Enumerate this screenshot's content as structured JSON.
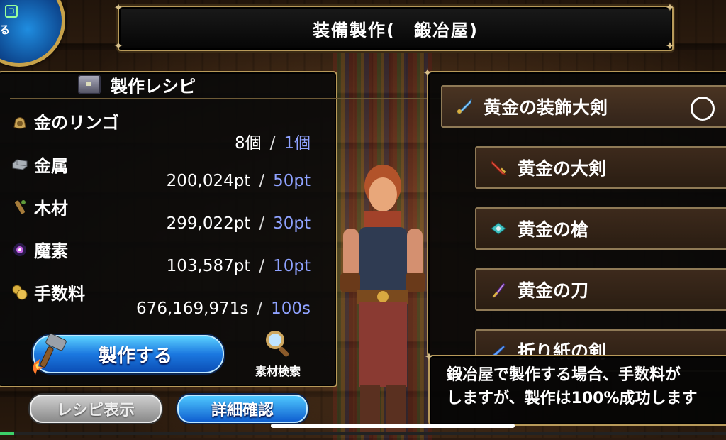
{
  "title": "装備製作(　鍛冶屋)",
  "corner_badge": {
    "label": "る",
    "icon": "menu-icon"
  },
  "recipe": {
    "heading": "製作レシピ",
    "materials": [
      {
        "name": "金のリンゴ",
        "have": "8個",
        "need": "1個",
        "icon": "apple-bag-icon"
      },
      {
        "name": "金属",
        "have": "200,024pt",
        "need": "50pt",
        "icon": "metal-ingot-icon"
      },
      {
        "name": "木材",
        "have": "299,022pt",
        "need": "30pt",
        "icon": "wood-icon"
      },
      {
        "name": "魔素",
        "have": "103,587pt",
        "need": "10pt",
        "icon": "magic-orb-icon"
      },
      {
        "name": "手数料",
        "have": "676,169,971s",
        "need": "100s",
        "icon": "coins-icon"
      }
    ],
    "separator": "/"
  },
  "buttons": {
    "make": "製作する",
    "material_search": "素材検索",
    "show_recipe": "レシピ表示",
    "details": "詳細確認"
  },
  "items": [
    {
      "name": "黄金の装飾大剣",
      "icon": "ornate-sword-icon",
      "selected": true
    },
    {
      "name": "黄金の大剣",
      "icon": "greatsword-icon"
    },
    {
      "name": "黄金の槍",
      "icon": "spear-icon"
    },
    {
      "name": "黄金の刀",
      "icon": "katana-icon"
    },
    {
      "name": "折り紙の剣",
      "icon": "origami-sword-icon"
    }
  ],
  "message": {
    "line1": "鍛冶屋で製作する場合、手数料が",
    "line2": "しますが、製作は100%成功します"
  },
  "colors": {
    "accent_need": "#8fa2ff",
    "frame": "#b89a5a",
    "button_blue": "#1b78e0"
  },
  "progress": 0.02
}
